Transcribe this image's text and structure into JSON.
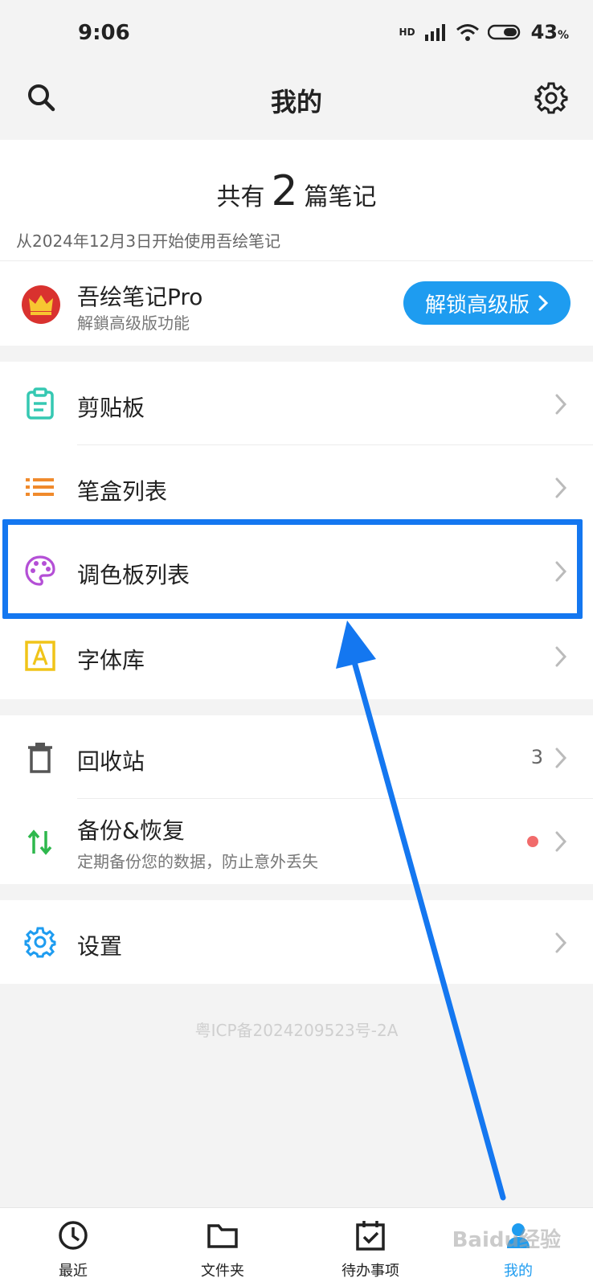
{
  "status": {
    "time": "9:06",
    "network": "HD",
    "battery": "43",
    "battery_unit": "%"
  },
  "header": {
    "title": "我的",
    "search_icon": "search-icon",
    "settings_icon": "gear-icon"
  },
  "summary": {
    "prefix": "共有",
    "count": "2",
    "suffix": "篇笔记",
    "since": "从2024年12月3日开始使用吾绘笔记"
  },
  "pro": {
    "title": "吾绘笔记Pro",
    "subtitle": "解鎖高级版功能",
    "button_label": "解锁高级版"
  },
  "menu_group_1": [
    {
      "label": "剪贴板",
      "icon": "clipboard-icon",
      "color": "#35c8b2"
    },
    {
      "label": "笔盒列表",
      "icon": "list-icon",
      "color": "#f08a2c"
    },
    {
      "label": "调色板列表",
      "icon": "palette-icon",
      "color": "#b44fd6"
    },
    {
      "label": "字体库",
      "icon": "font-icon",
      "color": "#f0c419"
    }
  ],
  "menu_group_2": [
    {
      "label": "回收站",
      "icon": "trash-icon",
      "count": "3"
    },
    {
      "label": "备份&恢复",
      "icon": "sync-arrows-icon",
      "subtitle": "定期备份您的数据，防止意外丢失"
    }
  ],
  "menu_group_3": [
    {
      "label": "设置",
      "icon": "gear-icon",
      "color": "#1e9cf0"
    }
  ],
  "footer": {
    "icp": "粤ICP备2024209523号-2A"
  },
  "bottom_nav": [
    {
      "label": "最近",
      "icon": "clock-icon"
    },
    {
      "label": "文件夹",
      "icon": "folder-icon"
    },
    {
      "label": "待办事项",
      "icon": "calendar-check-icon"
    },
    {
      "label": "我的",
      "icon": "user-icon",
      "active": true
    }
  ],
  "colors": {
    "accent": "#1e9cf0",
    "highlight": "#1477f0"
  },
  "watermark": "Baidu经验"
}
